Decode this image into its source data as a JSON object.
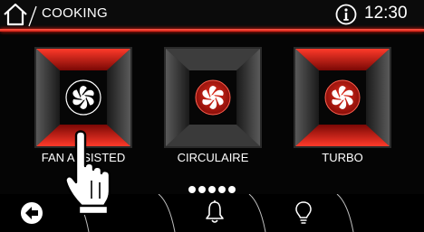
{
  "header": {
    "title": "COOKING",
    "time": "12:30",
    "accent_color": "#e8281b"
  },
  "modes": [
    {
      "label": "FAN ASSISTED",
      "icon": "fan-icon",
      "state": "highlighted"
    },
    {
      "label": "CIRCULAIRE",
      "icon": "fan-icon",
      "state": "normal"
    },
    {
      "label": "TURBO",
      "icon": "fan-icon",
      "state": "normal"
    }
  ],
  "pager": {
    "pages": 5
  },
  "bottom_bar": {
    "back_icon": "back-arrow-icon",
    "bell_icon": "bell-icon",
    "bulb_icon": "light-bulb-icon"
  },
  "overlay": {
    "icon": "hand-pointer-icon"
  }
}
